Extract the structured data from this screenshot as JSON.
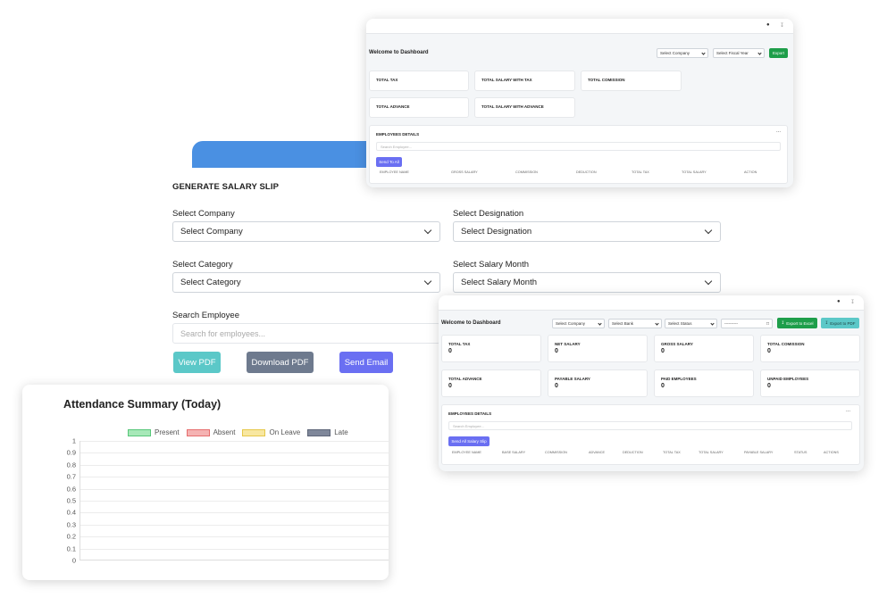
{
  "salary_slip": {
    "title": "GENERATE SALARY SLIP",
    "company": {
      "label": "Select Company",
      "value": "Select Company"
    },
    "designation": {
      "label": "Select Designation",
      "value": "Select Designation"
    },
    "category": {
      "label": "Select Category",
      "value": "Select Category"
    },
    "salary_month": {
      "label": "Select Salary Month",
      "value": "Select Salary Month"
    },
    "search": {
      "label": "Search Employee",
      "placeholder": "Search for employees..."
    },
    "buttons": {
      "view_pdf": "View PDF",
      "download_pdf": "Download PDF",
      "send_email": "Send Email"
    },
    "colors": {
      "view_pdf": "#5bc8c8",
      "download_pdf": "#6e7a8e",
      "send_email": "#6a6ff2",
      "tab": "#4a90e2"
    }
  },
  "attendance": {
    "title": "Attendance Summary (Today)",
    "legend": [
      {
        "label": "Present",
        "fill": "#a7e8b8",
        "stroke": "#58c77a"
      },
      {
        "label": "Absent",
        "fill": "#f5b3b3",
        "stroke": "#e66e6e"
      },
      {
        "label": "On Leave",
        "fill": "#f8e7a1",
        "stroke": "#e6c84a"
      },
      {
        "label": "Late",
        "fill": "#7f879a",
        "stroke": "#5d6578"
      }
    ],
    "chart_data": {
      "type": "bar",
      "title": "Attendance Summary (Today)",
      "series": [
        {
          "name": "Present",
          "values": []
        },
        {
          "name": "Absent",
          "values": []
        },
        {
          "name": "On Leave",
          "values": []
        },
        {
          "name": "Late",
          "values": []
        }
      ],
      "yticks": [
        "1",
        "0.9",
        "0.8",
        "0.7",
        "0.6",
        "0.5",
        "0.4",
        "0.3",
        "0.2",
        "0.1",
        "0"
      ],
      "ylim": [
        0,
        1
      ],
      "grid": true,
      "legend_position": "top"
    }
  },
  "dashboard1": {
    "title": "Welcome to Dashboard",
    "select_company": "Select Company",
    "select_fiscal_year": "Select Fiscal Year",
    "export": "Export",
    "cards": [
      {
        "label": "TOTAL TAX"
      },
      {
        "label": "TOTAL SALARY WITH TAX"
      },
      {
        "label": "TOTAL COMISSION"
      },
      {
        "label": "TOTAL ADVANCE"
      },
      {
        "label": "TOTAL SALARY WITH ADVANCE"
      }
    ],
    "employees": {
      "title": "EMPLOYEES DETAILS",
      "menu": "...",
      "search_placeholder": "Search Employee...",
      "send_button": "Send To All",
      "columns": [
        "EMPLOYEE NAME",
        "GROSS SALARY",
        "COMMISSION",
        "DEDUCTION",
        "TOTAL TAX",
        "TOTAL SALARY",
        "ACTION"
      ]
    },
    "export_color": "#1e9e4a"
  },
  "dashboard2": {
    "title": "Welcome to Dashboard",
    "select_company": "Select Company",
    "select_bank": "Select Bank",
    "select_status": "Select Status",
    "date_placeholder": "----------",
    "export_excel": "Export to Excel",
    "export_pdf": "Export to PDF",
    "cards": [
      {
        "label": "TOTAL TAX",
        "value": "0"
      },
      {
        "label": "NET SALARY",
        "value": "0"
      },
      {
        "label": "GROSS SALARY",
        "value": "0"
      },
      {
        "label": "TOTAL COMISSION",
        "value": "0"
      },
      {
        "label": "TOTAL ADVANCE",
        "value": "0"
      },
      {
        "label": "PAYABLE SALARY",
        "value": "0"
      },
      {
        "label": "PAID EMPLOYEES",
        "value": "0"
      },
      {
        "label": "UNPAID EMPLOYEES",
        "value": "0"
      }
    ],
    "employees": {
      "title": "EMPLOYEES DETAILS",
      "menu": "...",
      "search_placeholder": "Search Employee...",
      "send_button": "Send All Salary Slip",
      "columns": [
        "EMPLOYEE NAME",
        "BASE SALARY",
        "COMMISSION",
        "ADVANCE",
        "DEDUCTION",
        "TOTAL TAX",
        "TOTAL SALARY",
        "PAYABLE SALARY",
        "STATUS",
        "ACTIONS"
      ]
    },
    "export_excel_color": "#1e9e4a",
    "export_pdf_color": "#5bc8c8"
  },
  "icons": {
    "bell": "bell-icon",
    "user": "user-icon",
    "download": "download-icon",
    "calendar": "calendar-icon"
  }
}
